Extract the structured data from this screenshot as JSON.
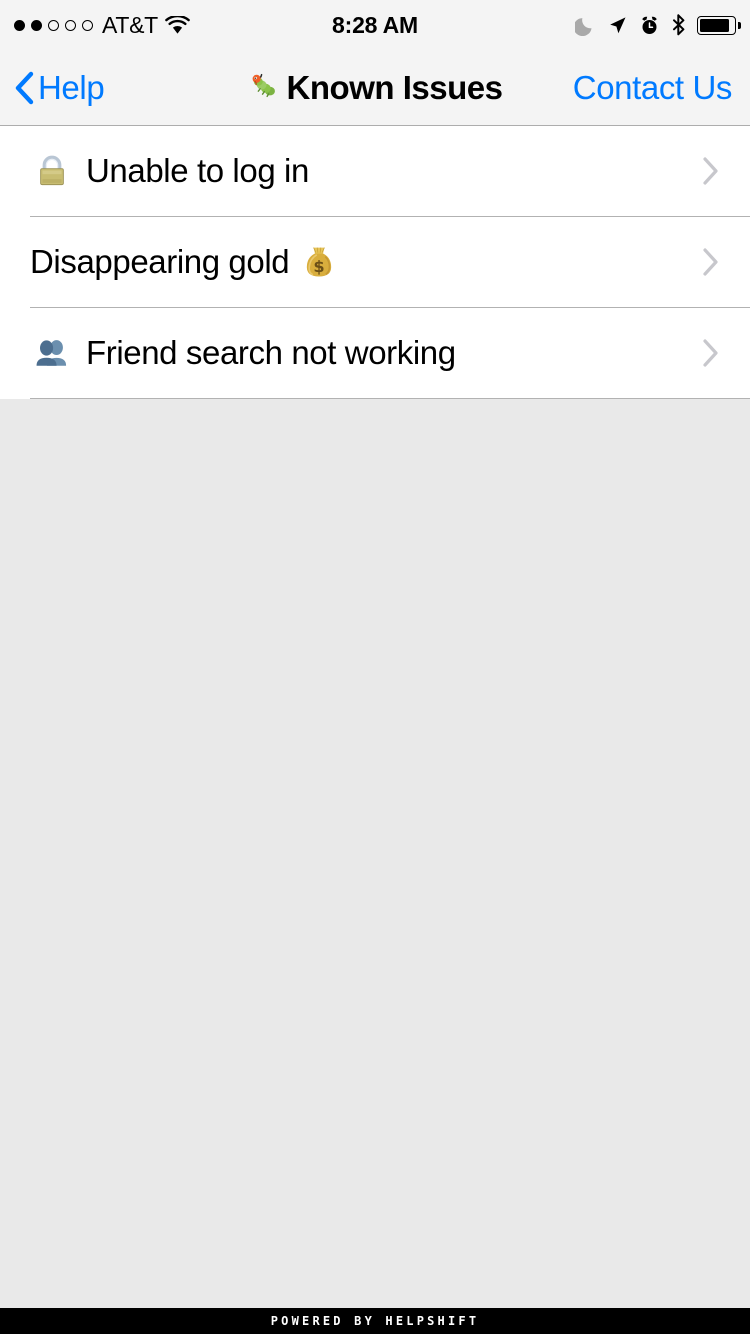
{
  "status_bar": {
    "signal_dots_total": 5,
    "signal_dots_filled": 2,
    "carrier": "AT&T",
    "wifi_icon": "wifi-icon",
    "time": "8:28 AM",
    "icons": [
      {
        "name": "do-not-disturb-moon-icon",
        "color": "#a9a9a9"
      },
      {
        "name": "location-arrow-icon",
        "color": "#000000"
      },
      {
        "name": "alarm-clock-icon",
        "color": "#000000"
      },
      {
        "name": "bluetooth-icon",
        "color": "#000000"
      },
      {
        "name": "battery-full-icon",
        "color": "#000000"
      }
    ]
  },
  "nav_bar": {
    "back_label": "Help",
    "back_icon": "chevron-left-icon",
    "title_emoji": "bug-emoji",
    "title": "Known Issues",
    "right_action": "Contact Us",
    "accent_color": "#007aff",
    "background_color": "#f4f4f4"
  },
  "issues": [
    {
      "leading_emoji": "lock-emoji",
      "label": "Unable to log in",
      "trailing_emoji": null,
      "accessory": "chevron-right-icon"
    },
    {
      "leading_emoji": null,
      "label": "Disappearing gold",
      "trailing_emoji": "money-bag-emoji",
      "accessory": "chevron-right-icon"
    },
    {
      "leading_emoji": "busts-in-silhouette-emoji",
      "label": "Friend search not working",
      "trailing_emoji": null,
      "accessory": "chevron-right-icon"
    }
  ],
  "footer": {
    "text": "POWERED BY HELPSHIFT",
    "background_color": "#000000",
    "text_color": "#ffffff"
  },
  "colors": {
    "page_background": "#e9e9e9",
    "list_background": "#ffffff",
    "separator": "#b2b2b2",
    "chevron": "#c7c7cc"
  }
}
